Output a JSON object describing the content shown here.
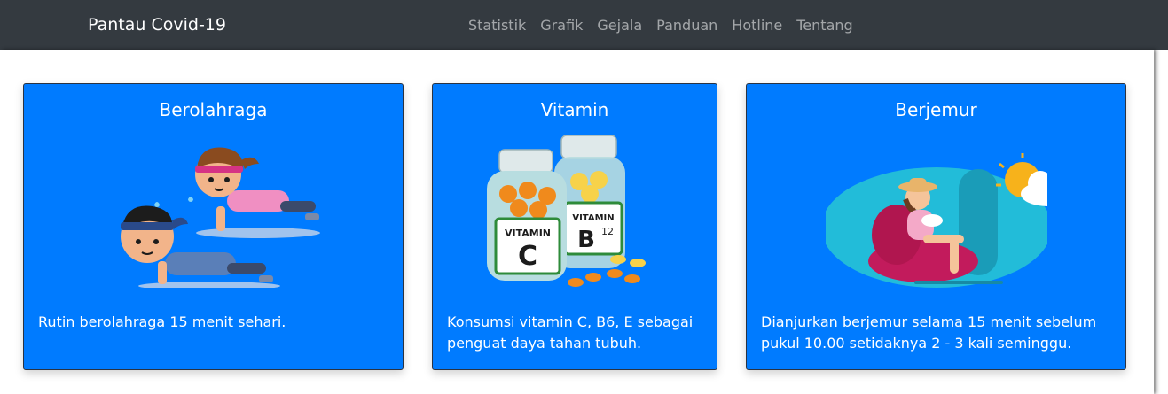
{
  "navbar": {
    "brand": "Pantau Covid-19",
    "links": [
      "Statistik",
      "Grafik",
      "Gejala",
      "Panduan",
      "Hotline",
      "Tentang"
    ]
  },
  "cards": [
    {
      "title": "Berolahraga",
      "text": "Rutin berolahraga 15 menit sehari.",
      "image_icon": "push-up-exercise-illustration"
    },
    {
      "title": "Vitamin",
      "text": "Konsumsi vitamin C, B6, E sebagai penguat daya tahan tubuh.",
      "image_icon": "vitamin-bottles-illustration",
      "bottle_labels": {
        "c_word": "VITAMIN",
        "c_letter": "C",
        "b_word": "VITAMIN",
        "b_letter": "B",
        "b_sub": "12"
      }
    },
    {
      "title": "Berjemur",
      "text": "Dianjurkan berjemur selama 15 menit sebelum pukul 10.00 setidaknya 2 - 3 kali seminggu.",
      "image_icon": "sunbathing-illustration"
    }
  ],
  "colors": {
    "navbar_bg": "#343a40",
    "card_bg": "#007bff",
    "nav_link": "rgba(255,255,255,0.55)"
  }
}
